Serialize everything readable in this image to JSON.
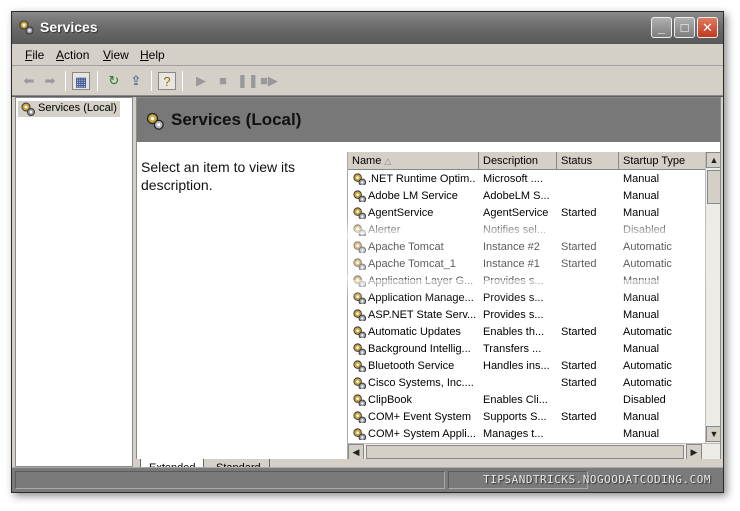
{
  "window": {
    "title": "Services",
    "buttons": {
      "minimize": "_",
      "maximize": "□",
      "close": "✕"
    }
  },
  "menu": {
    "items": [
      {
        "key": "F",
        "rest": "ile"
      },
      {
        "key": "A",
        "rest": "ction"
      },
      {
        "key": "V",
        "rest": "iew"
      },
      {
        "key": "H",
        "rest": "elp"
      }
    ]
  },
  "tree": {
    "root": "Services (Local)"
  },
  "pane": {
    "title": "Services (Local)",
    "description": "Select an item to view its description."
  },
  "list": {
    "columns": [
      "Name",
      "Description",
      "Status",
      "Startup Type"
    ],
    "rows": [
      [
        ".NET Runtime Optim...",
        "Microsoft ....",
        "",
        "Manual"
      ],
      [
        "Adobe LM Service",
        "AdobeLM S...",
        "",
        "Manual"
      ],
      [
        "AgentService",
        "AgentService",
        "Started",
        "Manual"
      ],
      [
        "Alerter",
        "Notifies sel...",
        "",
        "Disabled"
      ],
      [
        "Apache Tomcat",
        "Instance #2",
        "Started",
        "Automatic"
      ],
      [
        "Apache Tomcat_1",
        "Instance #1",
        "Started",
        "Automatic"
      ],
      [
        "Application Layer G...",
        "Provides s...",
        "",
        "Manual"
      ],
      [
        "Application Manage...",
        "Provides s...",
        "",
        "Manual"
      ],
      [
        "ASP.NET State Serv...",
        "Provides s...",
        "",
        "Manual"
      ],
      [
        "Automatic Updates",
        "Enables th...",
        "Started",
        "Automatic"
      ],
      [
        "Background Intellig...",
        "Transfers ...",
        "",
        "Manual"
      ],
      [
        "Bluetooth Service",
        "Handles ins...",
        "Started",
        "Automatic"
      ],
      [
        "Cisco Systems, Inc....",
        "",
        "Started",
        "Automatic"
      ],
      [
        "ClipBook",
        "Enables Cli...",
        "",
        "Disabled"
      ],
      [
        "COM+ Event System",
        "Supports S...",
        "Started",
        "Manual"
      ],
      [
        "COM+ System Appli...",
        "Manages t...",
        "",
        "Manual"
      ]
    ]
  },
  "tabs": {
    "extended": "Extended",
    "standard": "Standard"
  },
  "watermark": "TIPSANDTRICKS.NOGOODATCODING.COM",
  "colors": {
    "highlight": "#ffffff",
    "chrome": "#d4d0c8",
    "header": "#787878"
  }
}
